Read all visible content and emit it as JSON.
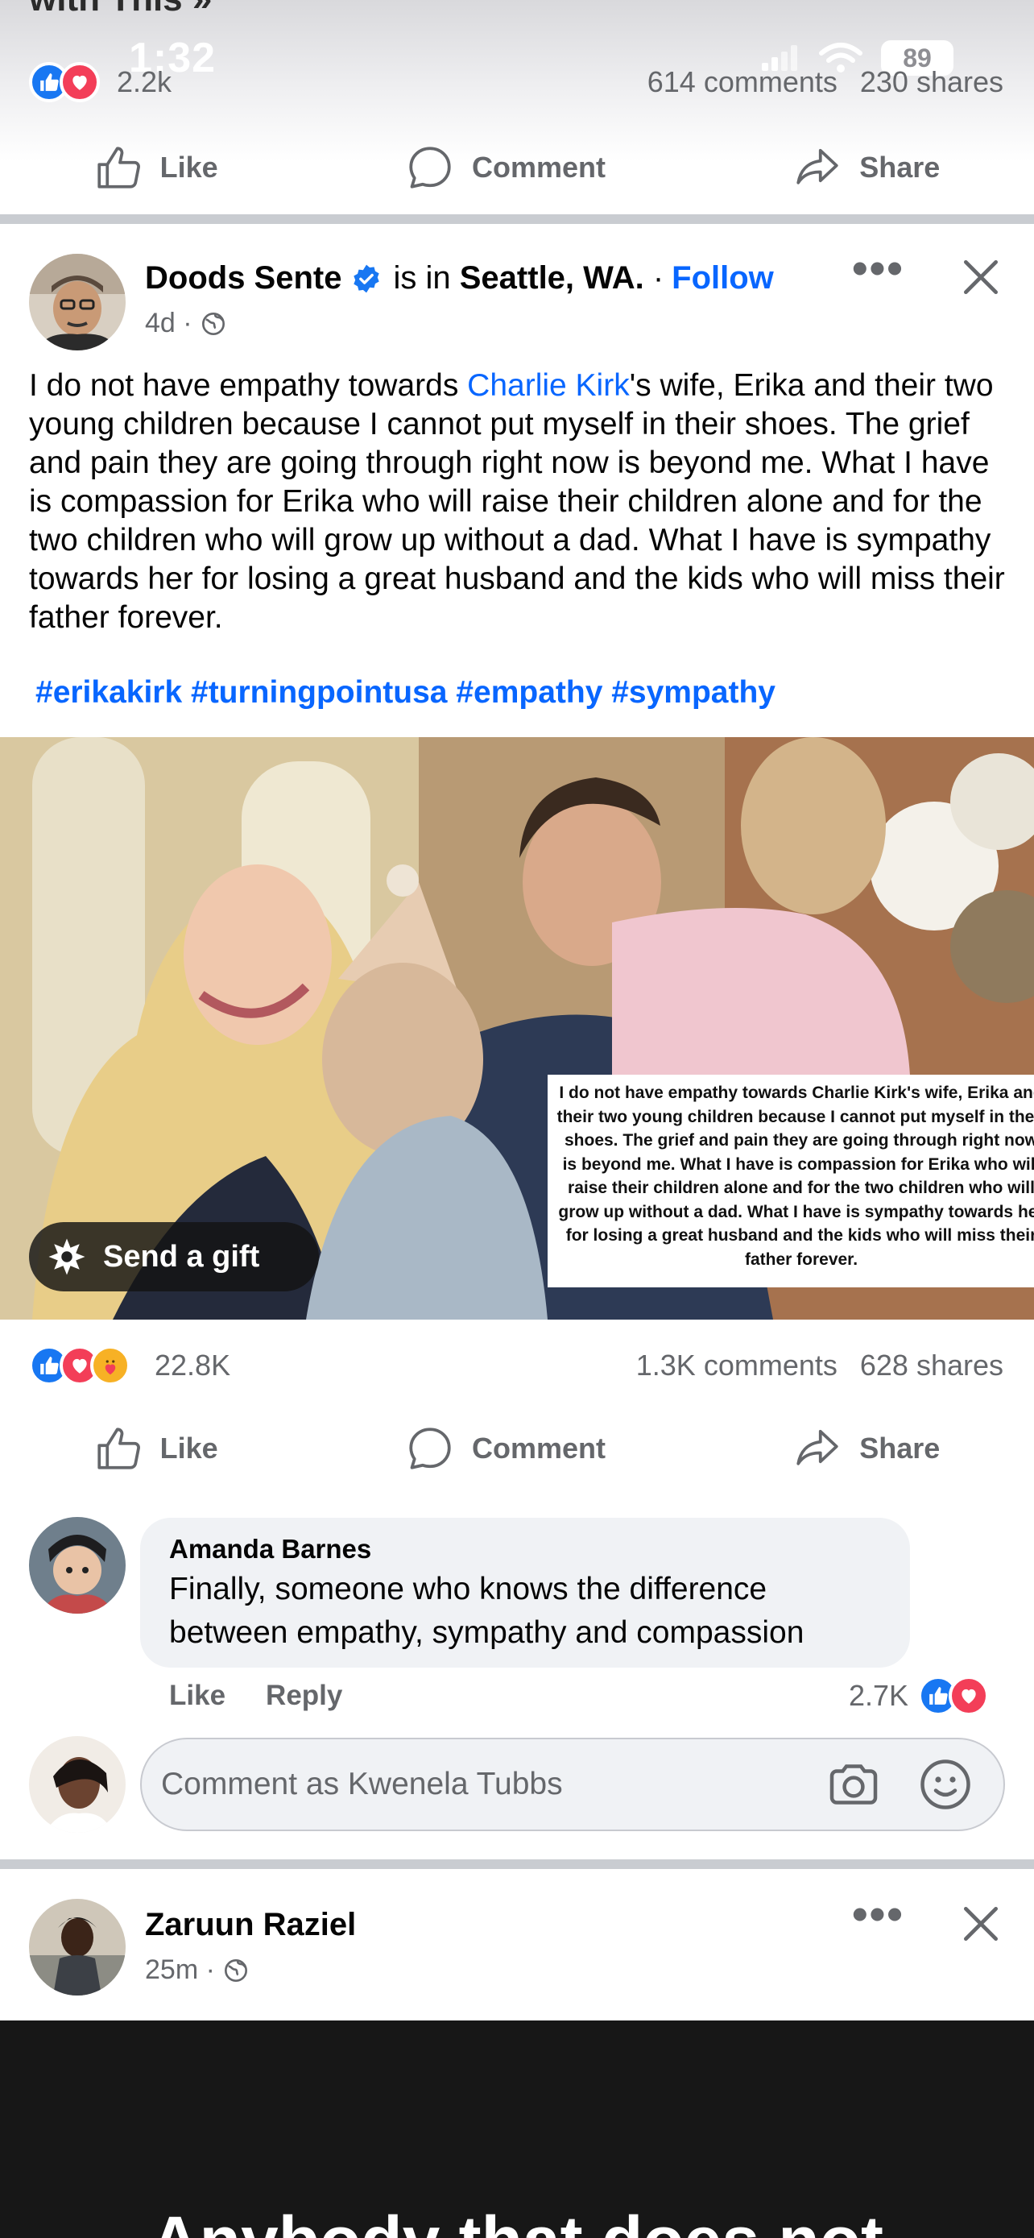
{
  "status_bar": {
    "time": "1:32",
    "battery": "89"
  },
  "previous_post": {
    "title_fragment": "with This »",
    "reaction_count": "2.2k",
    "comments": "614 comments",
    "shares": "230 shares"
  },
  "actions": {
    "like": "Like",
    "comment": "Comment",
    "share": "Share"
  },
  "post": {
    "author": "Doods Sente",
    "location_prefix": "is in",
    "location": "Seattle, WA.",
    "separator": "·",
    "follow": "Follow",
    "time": "4d ·",
    "text_before_mention": "I do not have empathy towards ",
    "mention": "Charlie Kirk",
    "text_after_mention": "'s wife, Erika and their two young children because I cannot put myself in their shoes. The grief and pain they are going through right now is beyond me. What I have is compassion for Erika who will raise their children alone and for the two children who will grow up without a dad. What I have is sympathy towards her for losing a great husband and the kids who will miss their father forever.",
    "hashtags": "#erikakirk #turningpointusa #empathy #sympathy",
    "photo_quote": "I do not have empathy towards Charlie Kirk's wife, Erika and their two young children because I cannot put myself in their shoes. The grief and pain they are going through right now is beyond me. What I have is compassion for Erika who will raise their children alone and for the two children who will grow up without a dad. What I have is sympathy towards her for losing a great husband and the kids who will miss their father forever.",
    "send_gift": "Send a gift",
    "reaction_count": "22.8K",
    "comments": "1.3K comments",
    "shares": "628 shares"
  },
  "top_comment": {
    "author": "Amanda Barnes",
    "text": "Finally, someone who knows the difference between empathy, sympathy and compassion",
    "like": "Like",
    "reply": "Reply",
    "reaction_count": "2.7K"
  },
  "comment_input": {
    "placeholder": "Comment as Kwenela Tubbs"
  },
  "next_post": {
    "author": "Zaruun Raziel",
    "time": "25m ·",
    "video_caption": "Anybody that does not"
  },
  "colors": {
    "link_blue": "#0866ff",
    "like_blue": "#1877f2",
    "love_red": "#f33e58",
    "care_yellow": "#f7b125",
    "secondary_text": "#65676b"
  },
  "icons": [
    "like-icon",
    "comment-icon",
    "share-icon",
    "verified-badge-icon",
    "globe-icon",
    "more-icon",
    "close-icon",
    "gift-icon",
    "camera-icon",
    "sticker-icon",
    "signal-icon",
    "wifi-icon"
  ]
}
